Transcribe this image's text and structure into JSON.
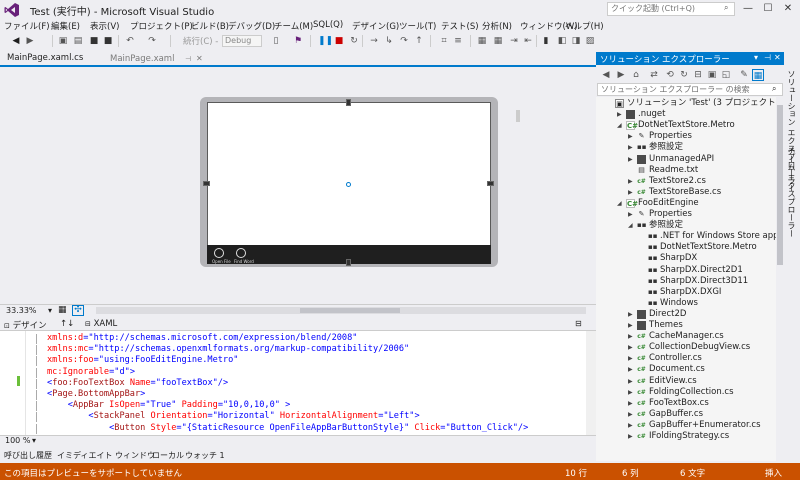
{
  "window": {
    "title": "Test (実行中) - Microsoft Visual Studio",
    "quick_launch_placeholder": "クイック起動 (Ctrl+Q)"
  },
  "menu": [
    "ファイル(F)",
    "編集(E)",
    "表示(V)",
    "プロジェクト(P)",
    "ビルド(B)",
    "デバッグ(D)",
    "チーム(M)",
    "SQL(Q)",
    "デザイン(G)",
    "ツール(T)",
    "テスト(S)",
    "分析(N)",
    "ウィンドウ(W)",
    "ヘルプ(H)"
  ],
  "toolbar": {
    "run_label": "続行(C) -",
    "config": "Debug"
  },
  "doc_tabs": [
    {
      "label": "MainPage.xaml.cs"
    },
    {
      "label": "MainPage.xaml"
    }
  ],
  "designer": {
    "appbar_buttons": [
      {
        "label": "Open File"
      },
      {
        "label": "Find Word"
      }
    ]
  },
  "zoom": "33.33%",
  "split_tabs": {
    "design": "デザイン",
    "swap": "↑↓",
    "xaml": "XAML"
  },
  "code_lines": [
    {
      "indent": "",
      "parts": [
        [
          "attr",
          "xmlns:d"
        ],
        [
          "punct",
          "=\""
        ],
        [
          "val",
          "http://schemas.microsoft.com/expression/blend/2008"
        ],
        [
          "punct",
          "\""
        ]
      ]
    },
    {
      "indent": "",
      "parts": [
        [
          "attr",
          "xmlns:mc"
        ],
        [
          "punct",
          "=\""
        ],
        [
          "val",
          "http://schemas.openxmlformats.org/markup-compatibility/2006"
        ],
        [
          "punct",
          "\""
        ]
      ]
    },
    {
      "indent": "",
      "parts": [
        [
          "attr",
          "xmlns:foo"
        ],
        [
          "punct",
          "=\""
        ],
        [
          "val",
          "using:FooEditEngine.Metro"
        ],
        [
          "punct",
          "\""
        ]
      ]
    },
    {
      "indent": "",
      "parts": [
        [
          "attr",
          "mc:Ignorable"
        ],
        [
          "punct",
          "=\""
        ],
        [
          "val",
          "d"
        ],
        [
          "punct",
          "\">"
        ]
      ]
    },
    {
      "indent": "",
      "parts": [
        [
          "punct",
          "<"
        ],
        [
          "kw",
          "foo:FooTextBox"
        ],
        [
          "punct",
          " "
        ],
        [
          "attr",
          "Name"
        ],
        [
          "punct",
          "=\""
        ],
        [
          "val",
          "fooTextBox"
        ],
        [
          "punct",
          "\"/>"
        ]
      ]
    },
    {
      "indent": "",
      "parts": [
        [
          "punct",
          "<"
        ],
        [
          "kw",
          "Page.BottomAppBar"
        ],
        [
          "punct",
          ">"
        ]
      ]
    },
    {
      "indent": "    ",
      "parts": [
        [
          "punct",
          "<"
        ],
        [
          "kw",
          "AppBar"
        ],
        [
          "punct",
          " "
        ],
        [
          "attr",
          "IsOpen"
        ],
        [
          "punct",
          "=\""
        ],
        [
          "val",
          "True"
        ],
        [
          "punct",
          "\" "
        ],
        [
          "attr",
          "Padding"
        ],
        [
          "punct",
          "=\""
        ],
        [
          "val",
          "10,0,10,0"
        ],
        [
          "punct",
          "\" >"
        ]
      ]
    },
    {
      "indent": "        ",
      "parts": [
        [
          "punct",
          "<"
        ],
        [
          "kw",
          "StackPanel"
        ],
        [
          "punct",
          " "
        ],
        [
          "attr",
          "Orientation"
        ],
        [
          "punct",
          "=\""
        ],
        [
          "val",
          "Horizontal"
        ],
        [
          "punct",
          "\" "
        ],
        [
          "attr",
          "HorizontalAlignment"
        ],
        [
          "punct",
          "=\""
        ],
        [
          "val",
          "Left"
        ],
        [
          "punct",
          "\">"
        ]
      ]
    },
    {
      "indent": "            ",
      "parts": [
        [
          "punct",
          "<"
        ],
        [
          "kw",
          "Button"
        ],
        [
          "punct",
          " "
        ],
        [
          "attr",
          "Style"
        ],
        [
          "punct",
          "=\""
        ],
        [
          "val",
          "{StaticResource OpenFileAppBarButtonStyle}"
        ],
        [
          "punct",
          "\" "
        ],
        [
          "attr",
          "Click"
        ],
        [
          "punct",
          "=\""
        ],
        [
          "val",
          "Button_Click"
        ],
        [
          "punct",
          "\"/>"
        ]
      ]
    }
  ],
  "code_zoom": "100 %",
  "bottom_tabs": [
    "呼び出し履歴",
    "イミディエイト ウィンドウ",
    "ローカル",
    "ウォッチ 1"
  ],
  "solution_explorer": {
    "title": "ソリューション エクスプローラー",
    "search_placeholder": "ソリューション エクスプローラー の検索 (Ctrl+;)",
    "nodes": [
      {
        "label": "ソリューション 'Test' (3 プロジェクト)",
        "depth": 0,
        "icon": "solution-icon",
        "expander": ""
      },
      {
        "label": ".nuget",
        "depth": 1,
        "icon": "folder-icon",
        "expander": "▶"
      },
      {
        "label": "DotNetTextStore.Metro",
        "depth": 1,
        "icon": "csproject-icon",
        "expander": "◢"
      },
      {
        "label": "Properties",
        "depth": 2,
        "icon": "wrench-icon",
        "expander": "▶"
      },
      {
        "label": "参照設定",
        "depth": 2,
        "icon": "references-icon",
        "expander": "▶"
      },
      {
        "label": "UnmanagedAPI",
        "depth": 2,
        "icon": "folder-icon",
        "expander": "▶"
      },
      {
        "label": "Readme.txt",
        "depth": 2,
        "icon": "file-icon",
        "expander": ""
      },
      {
        "label": "TextStore2.cs",
        "depth": 2,
        "icon": "csharp-file-icon",
        "expander": "▶"
      },
      {
        "label": "TextStoreBase.cs",
        "depth": 2,
        "icon": "csharp-file-icon",
        "expander": "▶"
      },
      {
        "label": "FooEditEngine",
        "depth": 1,
        "icon": "csproject-icon",
        "expander": "◢"
      },
      {
        "label": "Properties",
        "depth": 2,
        "icon": "wrench-icon",
        "expander": "▶"
      },
      {
        "label": "参照設定",
        "depth": 2,
        "icon": "references-icon",
        "expander": "◢"
      },
      {
        "label": ".NET for Windows Store apps",
        "depth": 3,
        "icon": "reference-icon",
        "expander": ""
      },
      {
        "label": "DotNetTextStore.Metro",
        "depth": 3,
        "icon": "reference-icon",
        "expander": ""
      },
      {
        "label": "SharpDX",
        "depth": 3,
        "icon": "reference-icon",
        "expander": ""
      },
      {
        "label": "SharpDX.Direct2D1",
        "depth": 3,
        "icon": "reference-icon",
        "expander": ""
      },
      {
        "label": "SharpDX.Direct3D11",
        "depth": 3,
        "icon": "reference-icon",
        "expander": ""
      },
      {
        "label": "SharpDX.DXGI",
        "depth": 3,
        "icon": "reference-icon",
        "expander": ""
      },
      {
        "label": "Windows",
        "depth": 3,
        "icon": "reference-icon",
        "expander": ""
      },
      {
        "label": "Direct2D",
        "depth": 2,
        "icon": "folder-icon",
        "expander": "▶"
      },
      {
        "label": "Themes",
        "depth": 2,
        "icon": "folder-icon",
        "expander": "▶"
      },
      {
        "label": "CacheManager.cs",
        "depth": 2,
        "icon": "csharp-file-icon",
        "expander": "▶"
      },
      {
        "label": "CollectionDebugView.cs",
        "depth": 2,
        "icon": "csharp-file-icon",
        "expander": "▶"
      },
      {
        "label": "Controller.cs",
        "depth": 2,
        "icon": "csharp-file-icon",
        "expander": "▶"
      },
      {
        "label": "Document.cs",
        "depth": 2,
        "icon": "csharp-file-icon",
        "expander": "▶"
      },
      {
        "label": "EditView.cs",
        "depth": 2,
        "icon": "csharp-file-icon",
        "expander": "▶"
      },
      {
        "label": "FoldingCollection.cs",
        "depth": 2,
        "icon": "csharp-file-icon",
        "expander": "▶"
      },
      {
        "label": "FooTextBox.cs",
        "depth": 2,
        "icon": "csharp-file-icon",
        "expander": "▶"
      },
      {
        "label": "GapBuffer.cs",
        "depth": 2,
        "icon": "csharp-file-icon",
        "expander": "▶"
      },
      {
        "label": "GapBuffer+Enumerator.cs",
        "depth": 2,
        "icon": "csharp-file-icon",
        "expander": "▶"
      },
      {
        "label": "IFoldingStrategy.cs",
        "depth": 2,
        "icon": "csharp-file-icon",
        "expander": "▶"
      }
    ]
  },
  "side_tabs": [
    "ソリューション エクスプローラー",
    "チーム エクスプローラー"
  ],
  "status": {
    "message": "この項目はプレビューをサポートしていません",
    "line": "10 行",
    "col": "6 列",
    "chars": "6 文字",
    "mode": "挿入"
  },
  "colors": {
    "accent": "#007acc",
    "status_bar": "#ca5100"
  }
}
